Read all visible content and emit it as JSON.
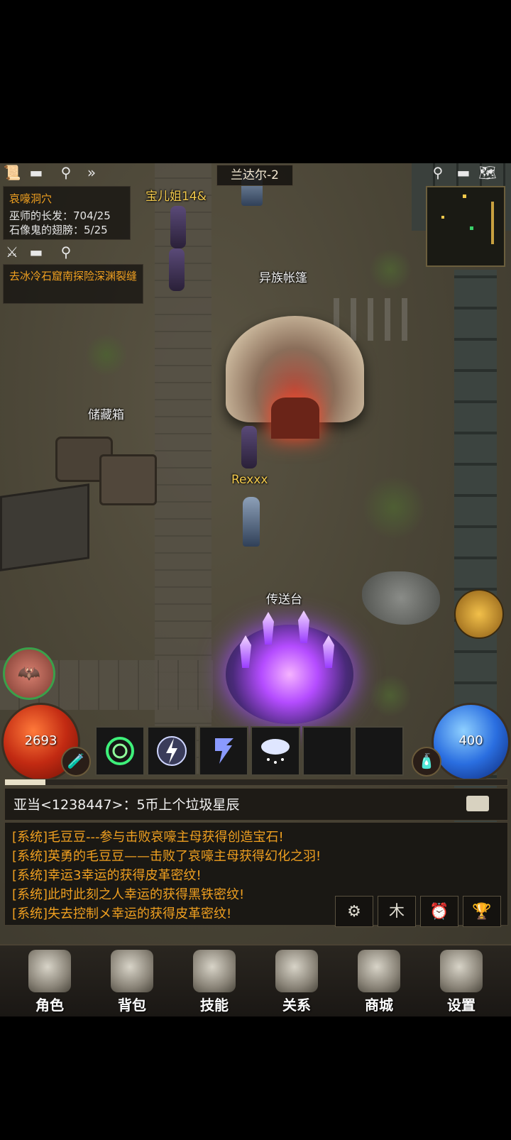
{
  "location": "兰达尔-2",
  "quest": {
    "title": "哀嚎洞穴",
    "items": [
      "巫师的长发：704/25",
      "石像鬼的翅膀：5/25"
    ],
    "next": "去冰冷石窟南探险深渊裂缝"
  },
  "hud_icons": {
    "left_row1": [
      "scroll-icon",
      "minimize-icon",
      "search-icon",
      "fast-forward-icon"
    ],
    "left_row2": [
      "crossed-swords-icon",
      "minimize-icon",
      "search-icon"
    ],
    "right_row": [
      "search-icon",
      "minimize-icon",
      "map-icon"
    ]
  },
  "map_labels": {
    "player_top": "宝儿姐14&",
    "tent": "异族帐篷",
    "storage": "储藏箱",
    "player": "Rexxx",
    "portal": "传送台"
  },
  "orbs": {
    "hp": "2693",
    "mp": "400"
  },
  "skills": [
    "whirlwind-skill-icon",
    "lightning-skill-icon",
    "speed-skill-icon",
    "storm-skill-icon",
    "",
    ""
  ],
  "xp_fraction": 0.08,
  "chat": {
    "header": "亚当<1238447>：5币上个垃圾星辰",
    "lines": [
      "[系统]毛豆豆---参与击败哀嚎主母获得创造宝石!",
      "[系统]英勇的毛豆豆——击败了哀嚎主母获得幻化之羽!",
      "[系统]幸运3幸运的获得皮革密纹!",
      "[系统]此时此刻之人幸运的获得黑铁密纹!",
      "[系统]失去控制メ幸运的获得皮革密纹!"
    ],
    "buttons": [
      "⚙",
      "木",
      "⏰",
      "🏆"
    ]
  },
  "menu": [
    {
      "label": "角色",
      "icon": "helmet-icon"
    },
    {
      "label": "背包",
      "icon": "backpack-icon"
    },
    {
      "label": "技能",
      "icon": "skill-book-icon"
    },
    {
      "label": "关系",
      "icon": "gauntlets-icon"
    },
    {
      "label": "商城",
      "icon": "treasure-chest-icon"
    },
    {
      "label": "设置",
      "icon": "gear-icon"
    }
  ]
}
